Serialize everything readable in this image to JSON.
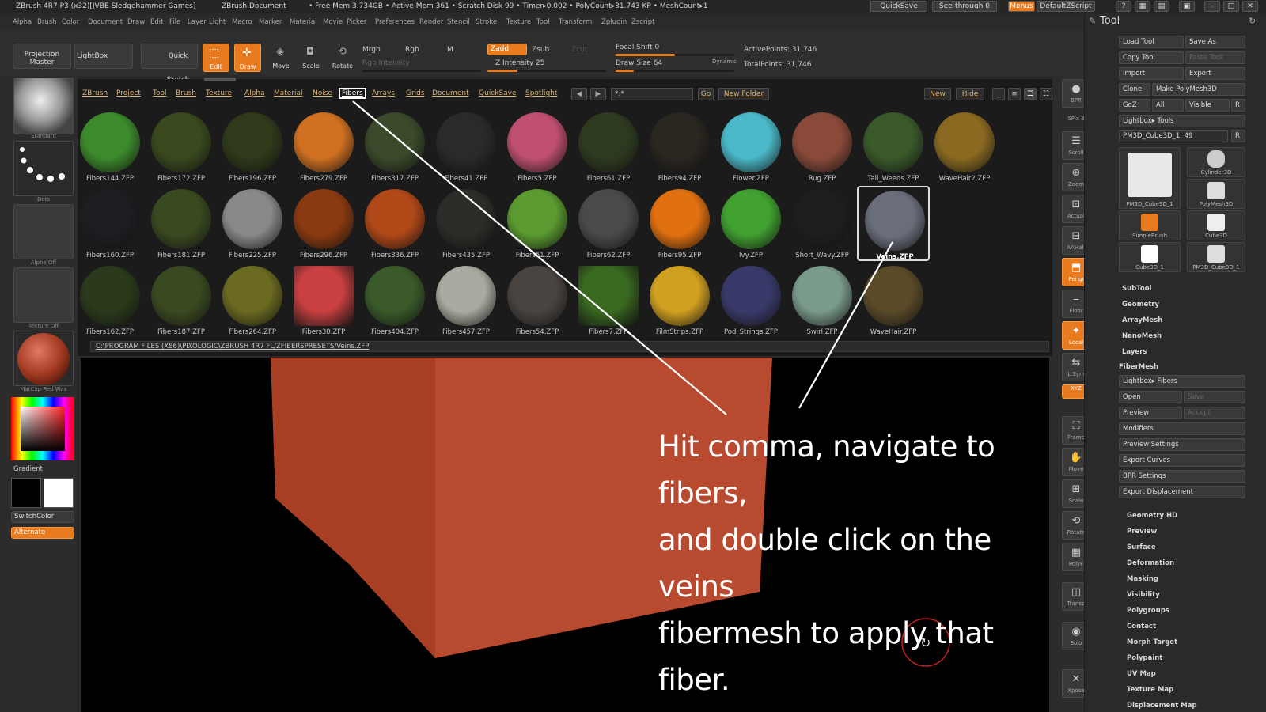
{
  "titlebar": {
    "app": "ZBrush 4R7 P3 (x32)[JVBE-Sledgehammer Games]",
    "doc": "ZBrush Document",
    "mem": "• Free Mem 3.734GB • Active Mem 361 • Scratch Disk 99 • Timer▸0.002 • PolyCount▸31.743 KP • MeshCount▸1",
    "quicksave": "QuickSave",
    "seethrough": "See-through 0",
    "menus": "Menus",
    "script": "DefaultZScript"
  },
  "menubar": [
    "Alpha",
    "Brush",
    "Color",
    "Document",
    "Draw",
    "Edit",
    "File",
    "Layer",
    "Light",
    "Macro",
    "Marker",
    "Material",
    "Movie",
    "Picker",
    "Preferences",
    "Render",
    "Stencil",
    "Stroke",
    "Texture",
    "Tool",
    "Transform",
    "Zplugin",
    "Zscript"
  ],
  "toolbar": {
    "projection_master": "Projection Master",
    "lightbox": "LightBox",
    "quick_sketch": "Quick Sketch",
    "edit": "Edit",
    "draw": "Draw",
    "move": "Move",
    "scale": "Scale",
    "rotate": "Rotate",
    "mrgb": "Mrgb",
    "rgb": "Rgb",
    "m": "M",
    "rgb_intensity": "Rgb Intensity",
    "zadd": "Zadd",
    "zsub": "Zsub",
    "zcut": "Zcut",
    "z_intensity": "Z Intensity 25",
    "focal_shift": "Focal Shift 0",
    "draw_size": "Draw Size 64",
    "dynamic": "Dynamic",
    "active_points": "ActivePoints: 31,746",
    "total_points": "TotalPoints: 31,746",
    "z_intensity_level": 0.25,
    "focal_shift_level": 0.5,
    "draw_size_level": 0.15
  },
  "leftpanel": {
    "standard": "Standard",
    "dots": "Dots",
    "alpha_off": "Alpha Off",
    "texture_off": "Texture Off",
    "matcap": "MatCap Red Wax",
    "gradient": "Gradient",
    "switchcolor": "SwitchColor",
    "alternate": "Alternate"
  },
  "lightbox": {
    "tabs": [
      "ZBrush",
      "Project",
      "Tool",
      "Brush",
      "Texture",
      "Alpha",
      "Material",
      "Noise",
      "Fibers",
      "Arrays",
      "Grids",
      "Document",
      "QuickSave",
      "Spotlight"
    ],
    "selected_tab": "Fibers",
    "search_value": "*.*",
    "go": "Go",
    "new_folder": "New Folder",
    "new": "New",
    "hide": "Hide",
    "path": "C:\\PROGRAM FILES (X86)\\PIXOLOGIC\\ZBRUSH 4R7 FL/ZFIBERSPRESETS/Veins.ZFP",
    "rows": [
      [
        "Fibers144.ZFP",
        "Fibers172.ZFP",
        "Fibers196.ZFP",
        "Fibers279.ZFP",
        "Fibers317.ZFP",
        "Fibers41.ZFP",
        "Fibers5.ZFP",
        "Fibers61.ZFP",
        "Fibers94.ZFP",
        "Flower.ZFP",
        "Rug.ZFP",
        "Tall_Weeds.ZFP",
        "WaveHair2.ZFP"
      ],
      [
        "Fibers160.ZFP",
        "Fibers181.ZFP",
        "Fibers225.ZFP",
        "Fibers296.ZFP",
        "Fibers336.ZFP",
        "Fibers435.ZFP",
        "Fibers51.ZFP",
        "Fibers62.ZFP",
        "Fibers95.ZFP",
        "Ivy.ZFP",
        "Short_Wavy.ZFP",
        "Veins.ZFP"
      ],
      [
        "Fibers162.ZFP",
        "Fibers187.ZFP",
        "Fibers264.ZFP",
        "Fibers30.ZFP",
        "Fibers404.ZFP",
        "Fibers457.ZFP",
        "Fibers54.ZFP",
        "Fibers7.ZFP",
        "FilmStrips.ZFP",
        "Pod_Strings.ZFP",
        "Swirl.ZFP",
        "WaveHair.ZFP"
      ]
    ],
    "selected_item": "Veins.ZFP"
  },
  "rightstrip": [
    "BPR",
    "SPix 3",
    "Scroll",
    "Zoom",
    "Actual",
    "AAHalf",
    "Persp",
    "Floor",
    "Local",
    "L.Sym",
    "XYZ",
    "Frame",
    "Move",
    "Scale",
    "Rotate",
    "PolyF",
    "Transp",
    "Solo",
    "Xpose"
  ],
  "toolpanel": {
    "title": "Tool",
    "load_tool": "Load Tool",
    "save_as": "Save As",
    "copy_tool": "Copy Tool",
    "paste_tool": "Paste Tool",
    "import": "Import",
    "export": "Export",
    "clone": "Clone",
    "make_polymesh": "Make PolyMesh3D",
    "goz": "GoZ",
    "all": "All",
    "visible": "Visible",
    "r": "R",
    "lightbox_tools": "Lightbox▸ Tools",
    "current_tool": "PM3D_Cube3D_1. 49",
    "tool_thumbs": [
      "PM3D_Cube3D_1",
      "Cylinder3D",
      "PolyMesh3D",
      "SimpleBrush",
      "Cube3D",
      "Cube3D_1",
      "PM3D_Cube3D_1"
    ],
    "sections_a": [
      "SubTool",
      "Geometry",
      "ArrayMesh",
      "NanoMesh",
      "Layers"
    ],
    "fibermesh": "FiberMesh",
    "lightbox_fibers": "Lightbox▸ Fibers",
    "open": "Open",
    "save": "Save",
    "preview": "Preview",
    "accept": "Accept",
    "fiber_items": [
      "Modifiers",
      "Preview Settings",
      "Export Curves",
      "BPR Settings",
      "Export Displacement"
    ],
    "sections_b": [
      "Geometry HD",
      "Preview",
      "Surface",
      "Deformation",
      "Masking",
      "Visibility",
      "Polygroups",
      "Contact",
      "Morph Target",
      "Polypaint",
      "UV Map",
      "Texture Map",
      "Displacement Map"
    ]
  },
  "annotation": {
    "lines": [
      "Hit comma, navigate to fibers,",
      "and double click on the veins",
      "fibermesh to apply that fiber."
    ]
  },
  "colors": {
    "accent": "#e87a20",
    "cube": "#b84a30"
  }
}
